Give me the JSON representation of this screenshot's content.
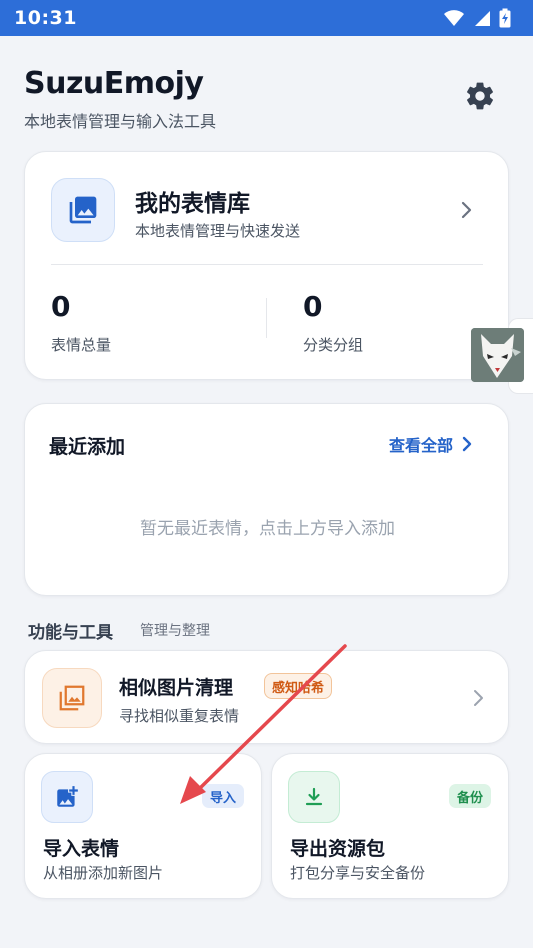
{
  "status_bar": {
    "time": "10:31",
    "icons": [
      "wifi-icon",
      "signal-icon",
      "battery-charging-icon"
    ],
    "color": "#2d6ed8"
  },
  "header": {
    "title": "SuzuEmojy",
    "subtitle": "本地表情管理与输入法工具",
    "settings_icon": "gear-icon"
  },
  "library_card": {
    "icon": "image-gallery-icon",
    "title": "我的表情库",
    "description": "本地表情管理与快速发送",
    "stats": [
      {
        "value": "0",
        "label": "表情总量"
      },
      {
        "value": "0",
        "label": "分类分组"
      }
    ]
  },
  "recent": {
    "title": "最近添加",
    "view_all": "查看全部",
    "empty_text": "暂无最近表情，点击上方导入添加"
  },
  "tools_section": {
    "title": "功能与工具",
    "subtitle": "管理与整理"
  },
  "similar_cleanup": {
    "icon": "image-stack-icon",
    "title": "相似图片清理",
    "badge": "感知哈希",
    "description": "寻找相似重复表情"
  },
  "import_tile": {
    "icon": "image-plus-icon",
    "badge": "导入",
    "title": "导入表情",
    "description": "从相册添加新图片"
  },
  "export_tile": {
    "icon": "download-icon",
    "badge": "备份",
    "title": "导出资源包",
    "description": "打包分享与安全备份"
  },
  "colors": {
    "accent": "#2563c9",
    "orange": "#d05a14",
    "green": "#1f8f4e",
    "annotation_arrow": "#e5484d"
  }
}
